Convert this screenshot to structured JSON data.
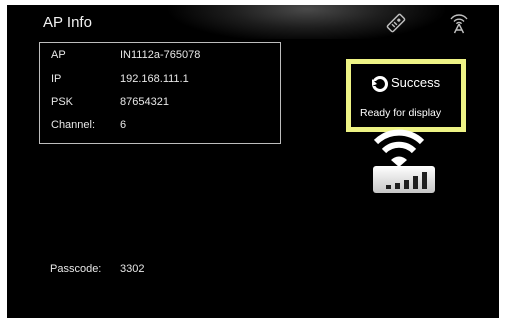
{
  "header": {
    "title": "AP Info",
    "icons": [
      "remote-icon",
      "wireless-antenna-icon"
    ]
  },
  "ap_info": {
    "rows": [
      {
        "label": "AP",
        "value": "IN1112a-765078"
      },
      {
        "label": "IP",
        "value": "192.168.111.1"
      },
      {
        "label": "PSK",
        "value": "87654321"
      },
      {
        "label": "Channel:",
        "value": "6"
      }
    ]
  },
  "status": {
    "title": "Success",
    "message": "Ready for display",
    "highlight_color": "#eef385",
    "icons": [
      "refresh-icon",
      "wifi-icon",
      "signal-strength-icon"
    ],
    "signal_bars": 5
  },
  "passcode": {
    "label": "Passcode:",
    "value": "3302"
  }
}
